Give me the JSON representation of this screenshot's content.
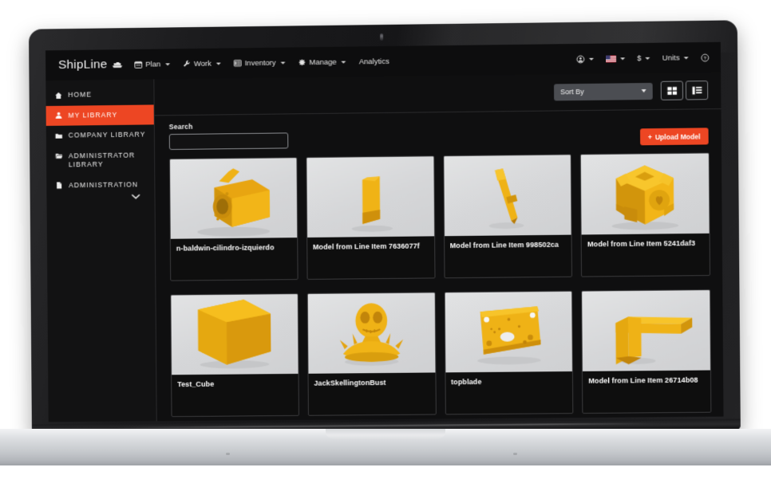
{
  "app": {
    "brand": "ShipLine",
    "brand_icon": "ship-icon"
  },
  "navbar": {
    "items": [
      {
        "label": "Plan",
        "icon": "calendar-icon",
        "has_caret": true
      },
      {
        "label": "Work",
        "icon": "wrench-icon",
        "has_caret": true
      },
      {
        "label": "Inventory",
        "icon": "list-icon",
        "has_caret": true
      },
      {
        "label": "Manage",
        "icon": "gear-icon",
        "has_caret": true
      },
      {
        "label": "Analytics",
        "icon": "",
        "has_caret": false
      }
    ],
    "right": [
      {
        "label": "",
        "icon": "user-circle-icon",
        "has_caret": true
      },
      {
        "label": "",
        "icon": "us-flag-icon",
        "has_caret": true
      },
      {
        "label": "$",
        "icon": "currency-icon",
        "has_caret": true
      },
      {
        "label": "Units",
        "icon": "",
        "has_caret": true
      },
      {
        "label": "",
        "icon": "help-circle-icon",
        "has_caret": false
      }
    ]
  },
  "sidebar": {
    "items": [
      {
        "label": "HOME",
        "icon": "home-icon",
        "active": false
      },
      {
        "label": "MY LIBRARY",
        "icon": "user-icon",
        "active": true
      },
      {
        "label": "COMPANY LIBRARY",
        "icon": "folder-icon",
        "active": false
      },
      {
        "label": "ADMINISTRATOR LIBRARY",
        "icon": "folder-open-icon",
        "active": false
      },
      {
        "label": "ADMINISTRATION",
        "icon": "file-icon",
        "active": false
      }
    ],
    "expand_chevron": "⌄"
  },
  "toolbar": {
    "sort_by_label": "Sort By",
    "grid_view_icon": "grid-view-icon",
    "list_view_icon": "list-view-icon"
  },
  "search": {
    "label": "Search",
    "value": "",
    "placeholder": ""
  },
  "actions": {
    "upload_label": "Upload Model",
    "upload_plus": "+"
  },
  "colors": {
    "accent": "#ED4623",
    "app_bg": "#0f0f10",
    "sidebar_bg": "#121213",
    "thumb_bg": "#d8d9db",
    "model_yellow": "#ECAF12"
  },
  "models": [
    {
      "title": "n-baldwin-cilindro-izquierdo",
      "shape": "cylinder-housing"
    },
    {
      "title": "Model from Line Item 7636077f",
      "shape": "bar"
    },
    {
      "title": "Model from Line Item 998502ca",
      "shape": "pen"
    },
    {
      "title": "Model from Line Item 5241daf3",
      "shape": "companion-cube"
    },
    {
      "title": "Test_Cube",
      "shape": "cube"
    },
    {
      "title": "JackSkellingtonBust",
      "shape": "bust"
    },
    {
      "title": "topblade",
      "shape": "plate"
    },
    {
      "title": "Model from Line Item 26714b08",
      "shape": "elbow"
    }
  ]
}
